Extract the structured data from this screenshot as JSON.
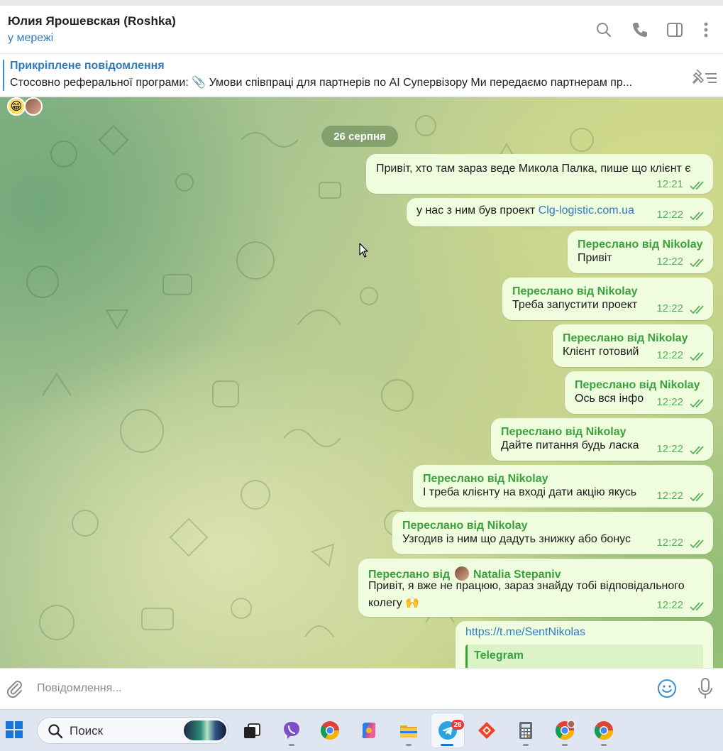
{
  "header": {
    "title": "Юлия Ярошевская (Roshka)",
    "status": "у мережі",
    "icons": [
      "search-icon",
      "phone-icon",
      "sidebar-toggle-icon",
      "more-vertical-icon"
    ]
  },
  "pinned": {
    "title": "Прикріплене повідомлення",
    "text": "Стосовно реферальної програми: 📎 Умови співпраці для партнерів по AI Супервізору Ми передаємо партнерам пр..."
  },
  "chat": {
    "date": "26 серпня",
    "messages": [
      {
        "text": "Привіт, хто там зараз веде Микола Палка, пише що клієнт є",
        "time": "12:21"
      },
      {
        "text_prefix": "у нас з ним був проект ",
        "link": "Clg-logistic.com.ua",
        "time": "12:22"
      },
      {
        "forwarded": "Переслано від Nikolay",
        "text": "Привіт",
        "time": "12:22"
      },
      {
        "forwarded": "Переслано від Nikolay",
        "text": "Треба запустити проект",
        "time": "12:22"
      },
      {
        "forwarded": "Переслано від Nikolay",
        "text": "Клієнт готовий",
        "time": "12:22"
      },
      {
        "forwarded": "Переслано від Nikolay",
        "text": "Ось вся інфо",
        "time": "12:22"
      },
      {
        "forwarded": "Переслано від Nikolay",
        "text": "Дайте питання будь ласка",
        "time": "12:22"
      },
      {
        "forwarded": "Переслано від Nikolay",
        "text": "І треба клієнту на вході дати акцію якусь",
        "time": "12:22"
      },
      {
        "forwarded": "Переслано від Nikolay",
        "text": "Узгодив із ним що дадуть знижку або бонус",
        "time": "12:22"
      },
      {
        "forwarded_prefix": "Переслано від",
        "forwarded_name": "Natalia Stepaniv",
        "line1": "Привіт, я вже не працюю, зараз знайду тобі відповідального",
        "line2": "колегу 🙌",
        "time": "12:22"
      },
      {
        "link": "https://t.me/SentNikolas",
        "preview_title": "Telegram"
      }
    ]
  },
  "composer": {
    "placeholder": "Повідомлення..."
  },
  "taskbar": {
    "search_label": "Поиск",
    "telegram_badge": "26",
    "apps": [
      "task-view-icon",
      "viber-icon",
      "chrome-icon",
      "copilot-icon",
      "file-explorer-icon",
      "telegram-icon",
      "anydesk-icon",
      "calculator-icon",
      "chrome-profile-icon",
      "chrome-icon"
    ]
  },
  "colors": {
    "accent": "#2f7cbf",
    "forward_name": "#3aa23c",
    "bubble": "#effdde",
    "time": "#5cae5a"
  }
}
